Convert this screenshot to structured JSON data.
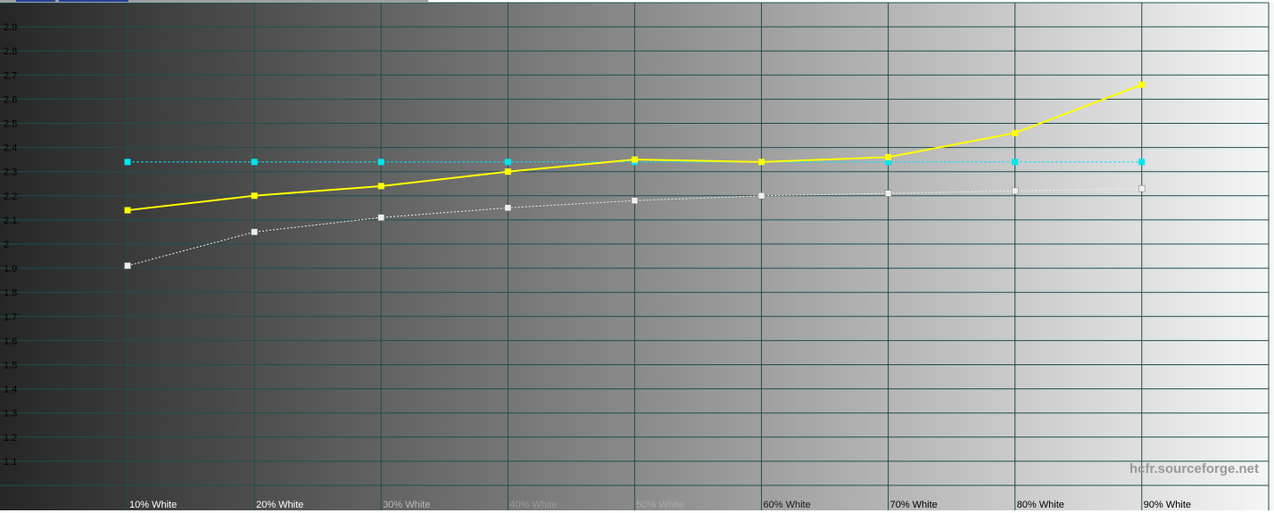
{
  "chart_data": {
    "type": "line",
    "categories": [
      "10% White",
      "20% White",
      "30% White",
      "40% White",
      "50% White",
      "60% White",
      "70% White",
      "80% White",
      "90% White"
    ],
    "y_ticks": [
      "1.1",
      "1.2",
      "1.3",
      "1.4",
      "1.5",
      "1.6",
      "1.7",
      "1.8",
      "1.9",
      "2",
      "2.1",
      "2.2",
      "2.3",
      "2.4",
      "2.5",
      "2.6",
      "2.7",
      "2.8",
      "2.9"
    ],
    "ylim": [
      1.0,
      3.0
    ],
    "grid": true,
    "background": "grayscale ramp from dark (#262626) to light (#f4f4f4)",
    "series": [
      {
        "values": [
          2.14,
          2.2,
          2.24,
          2.3,
          2.35,
          2.34,
          2.36,
          2.46,
          2.66
        ],
        "color": "#ffff00",
        "style": "solid"
      },
      {
        "values": [
          2.34,
          2.34,
          2.34,
          2.34,
          2.34,
          2.34,
          2.34,
          2.34,
          2.34
        ],
        "color": "#00e5f0",
        "style": "dashed"
      },
      {
        "values": [
          1.91,
          2.05,
          2.11,
          2.15,
          2.18,
          2.2,
          2.21,
          2.22,
          2.23
        ],
        "color": "#eeeeee",
        "style": "dotted"
      }
    ],
    "watermark": "hcfr.sourceforge.net"
  },
  "colors": {
    "grid": "#1f4f4f",
    "axis_text": "#000000"
  }
}
